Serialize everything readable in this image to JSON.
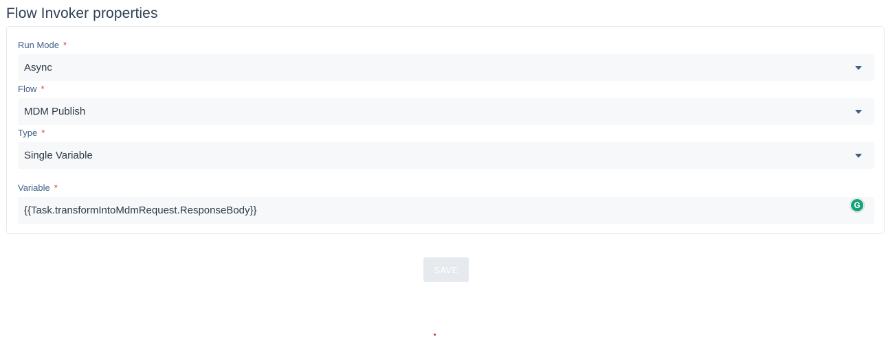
{
  "page": {
    "title": "Flow Invoker properties"
  },
  "form": {
    "required_marker": "*",
    "run_mode": {
      "label": "Run Mode",
      "value": "Async",
      "icon": "chevron-down-icon"
    },
    "flow": {
      "label": "Flow",
      "value": "MDM Publish",
      "icon": "chevron-down-icon"
    },
    "type": {
      "label": "Type",
      "value": "Single Variable",
      "icon": "chevron-down-icon"
    },
    "variable": {
      "label": "Variable",
      "value": "{{Task.transformIntoMdmRequest.ResponseBody}}",
      "icon": "grammarly-icon"
    }
  },
  "actions": {
    "save_label": "SAVE"
  },
  "colors": {
    "label": "#3f5f86",
    "required": "#e0373a",
    "field_bg": "#f6f8fa",
    "save_disabled_bg": "#e6e9ed",
    "grammarly": "#15a37a"
  }
}
